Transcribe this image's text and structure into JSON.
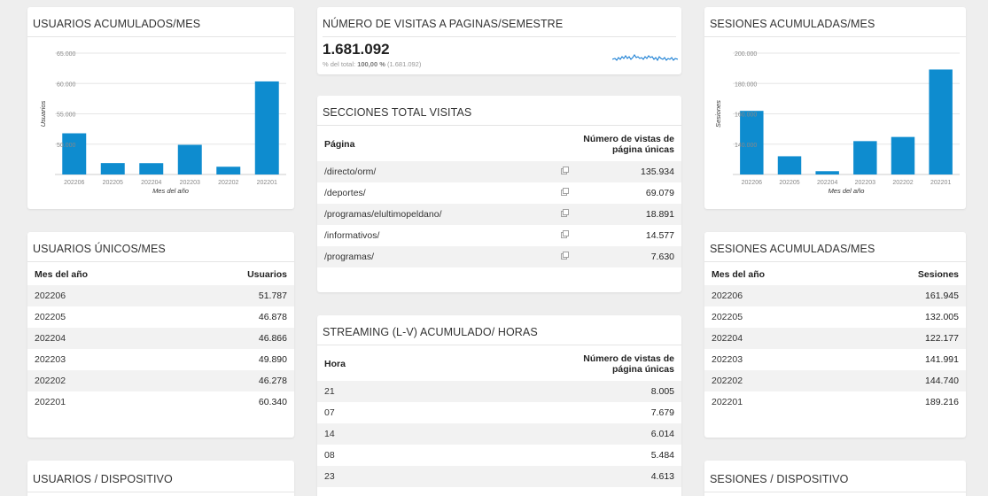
{
  "cards": {
    "usuarios_acum": {
      "title": "USUARIOS ACUMULADOS/MES",
      "chart_data": {
        "type": "bar",
        "title": "USUARIOS ACUMULADOS/MES",
        "xlabel": "Mes del año",
        "ylabel": "Usuarios",
        "categories": [
          "202206",
          "202205",
          "202204",
          "202203",
          "202202",
          "202201"
        ],
        "values": [
          51787,
          46878,
          46866,
          49890,
          46278,
          60340
        ],
        "ylim": [
          45000,
          65000
        ],
        "yticks": [
          "65.000",
          "60.000",
          "55.000",
          "50.000"
        ],
        "ytick_values": [
          65000,
          60000,
          55000,
          50000
        ],
        "grid": true,
        "color": "#0e8ccf"
      }
    },
    "visitas_semestre": {
      "title": "NÚMERO DE VISITAS A PAGINAS/SEMESTRE",
      "value": "1.681.092",
      "sub_prefix": "% del total: ",
      "sub_bold": "100,00 %",
      "sub_suffix": " (1.681.092)"
    },
    "sesiones_acum": {
      "title": "SESIONES ACUMULADAS/MES",
      "chart_data": {
        "type": "bar",
        "title": "SESIONES ACUMULADAS/MES",
        "xlabel": "Mes del año",
        "ylabel": "Sesiones",
        "categories": [
          "202206",
          "202205",
          "202204",
          "202203",
          "202202",
          "202201"
        ],
        "values": [
          161945,
          132005,
          122177,
          141991,
          144740,
          189216
        ],
        "ylim": [
          120000,
          200000
        ],
        "yticks": [
          "200.000",
          "180.000",
          "160.000",
          "140.000"
        ],
        "ytick_values": [
          200000,
          180000,
          160000,
          140000
        ],
        "grid": true,
        "color": "#0e8ccf"
      }
    },
    "secciones": {
      "title": "SECCIONES TOTAL VISITAS",
      "col1": "Página",
      "col2": "Número de vistas de página únicas",
      "rows": [
        {
          "label": "/directo/orm/",
          "value": "135.934"
        },
        {
          "label": "/deportes/",
          "value": "69.079"
        },
        {
          "label": "/programas/elultimopeldano/",
          "value": "18.891"
        },
        {
          "label": "/informativos/",
          "value": "14.577"
        },
        {
          "label": "/programas/",
          "value": "7.630"
        }
      ]
    },
    "usuarios_unicos": {
      "title": "USUARIOS ÚNICOS/MES",
      "col1": "Mes del año",
      "col2": "Usuarios",
      "rows": [
        {
          "label": "202206",
          "value": "51.787"
        },
        {
          "label": "202205",
          "value": "46.878"
        },
        {
          "label": "202204",
          "value": "46.866"
        },
        {
          "label": "202203",
          "value": "49.890"
        },
        {
          "label": "202202",
          "value": "46.278"
        },
        {
          "label": "202201",
          "value": "60.340"
        }
      ]
    },
    "sesiones_tabla": {
      "title": "SESIONES ACUMULADAS/MES",
      "col1": "Mes del año",
      "col2": "Sesiones",
      "rows": [
        {
          "label": "202206",
          "value": "161.945"
        },
        {
          "label": "202205",
          "value": "132.005"
        },
        {
          "label": "202204",
          "value": "122.177"
        },
        {
          "label": "202203",
          "value": "141.991"
        },
        {
          "label": "202202",
          "value": "144.740"
        },
        {
          "label": "202201",
          "value": "189.216"
        }
      ]
    },
    "streaming": {
      "title": "STREAMING (L-V) ACUMULADO/ HORAS",
      "col1": "Hora",
      "col2": "Número de vistas de página únicas",
      "rows": [
        {
          "label": "21",
          "value": "8.005"
        },
        {
          "label": "07",
          "value": "7.679"
        },
        {
          "label": "14",
          "value": "6.014"
        },
        {
          "label": "08",
          "value": "5.484"
        },
        {
          "label": "23",
          "value": "4.613"
        }
      ]
    },
    "usuarios_dispositivo": {
      "title": "USUARIOS / DISPOSITIVO"
    },
    "sesiones_dispositivo": {
      "title": "SESIONES / DISPOSITIVO"
    }
  },
  "icons": {
    "row_link": "external-link-icon"
  },
  "colors": {
    "bar": "#0e8ccf",
    "sparkline": "#1a7fd4"
  }
}
